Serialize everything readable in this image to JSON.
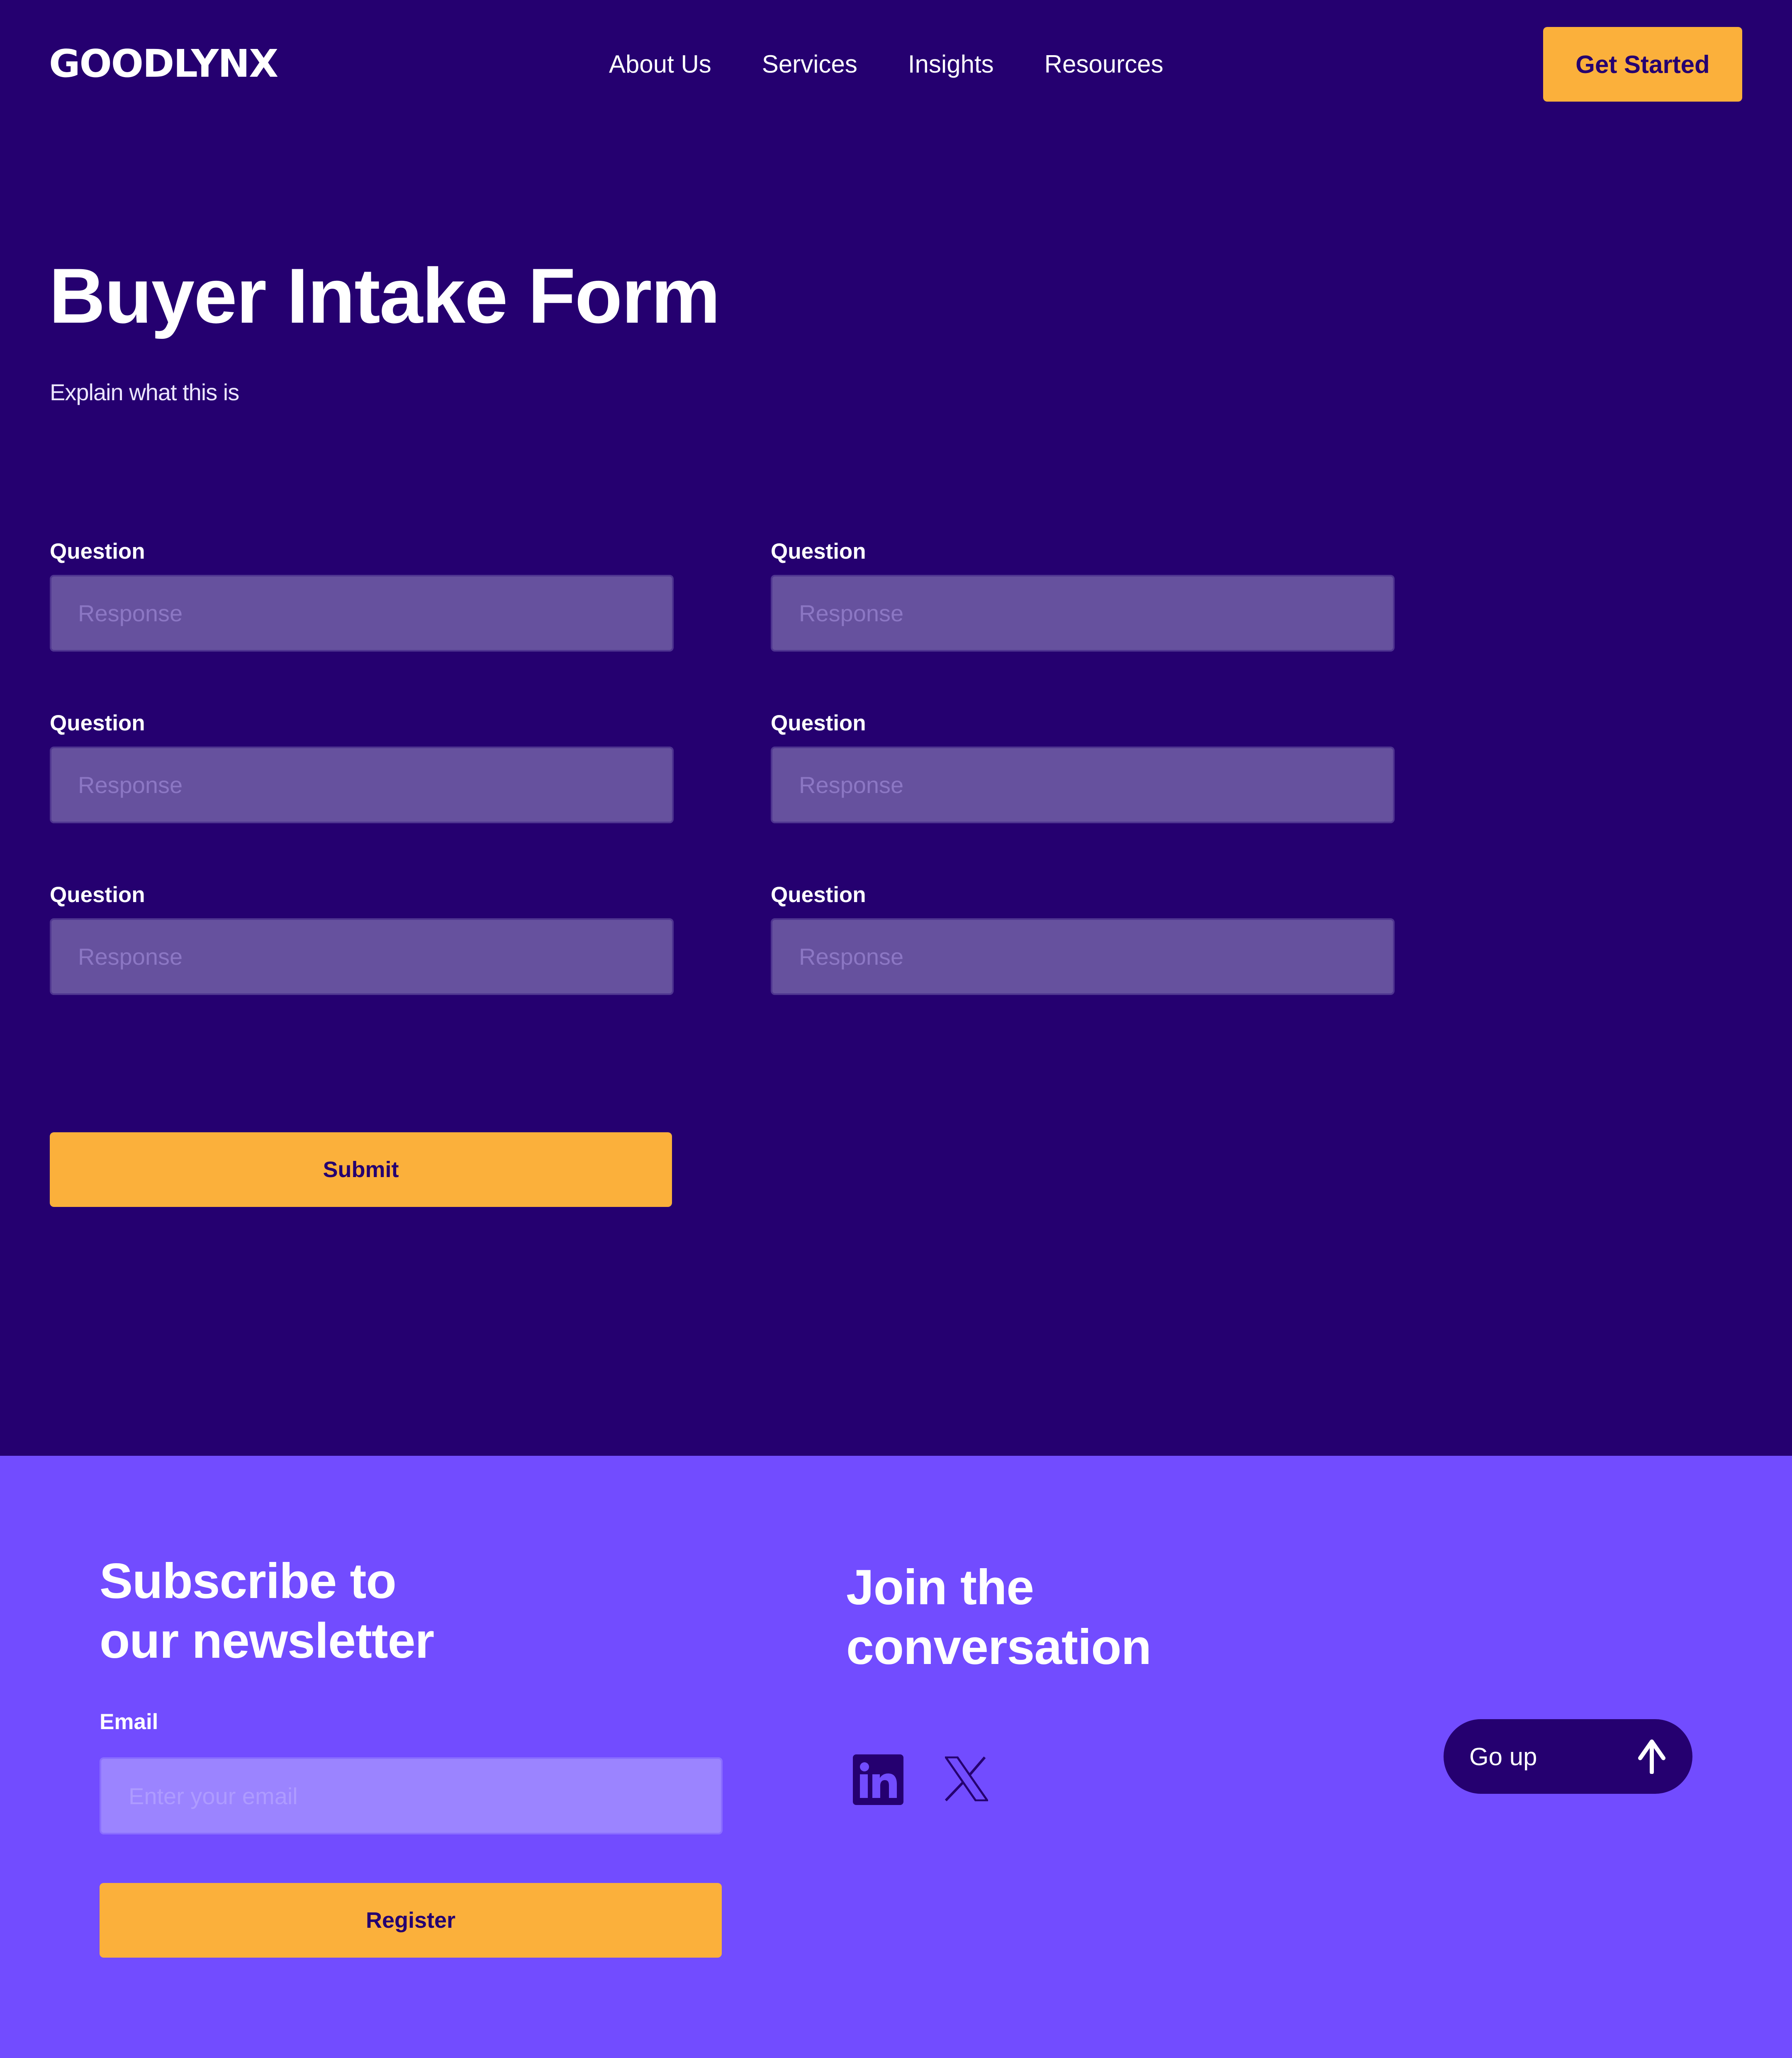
{
  "brand": {
    "logo_text": "GOODLYNX",
    "colors": {
      "primary_dark": "#250070",
      "footer_purple": "#724cff",
      "accent_orange": "#fbb03b",
      "input_fill": "#66519e",
      "text_white": "#ffffff"
    }
  },
  "nav": {
    "items": [
      {
        "label": "About Us"
      },
      {
        "label": "Services"
      },
      {
        "label": "Insights"
      },
      {
        "label": "Resources"
      }
    ],
    "cta_label": "Get Started"
  },
  "page": {
    "title": "Buyer Intake Form",
    "subtitle": "Explain what this is"
  },
  "form": {
    "fields": [
      {
        "label": "Question",
        "placeholder": "Response",
        "value": ""
      },
      {
        "label": "Question",
        "placeholder": "Response",
        "value": ""
      },
      {
        "label": "Question",
        "placeholder": "Response",
        "value": ""
      },
      {
        "label": "Question",
        "placeholder": "Response",
        "value": ""
      },
      {
        "label": "Question",
        "placeholder": "Response",
        "value": ""
      },
      {
        "label": "Question",
        "placeholder": "Response",
        "value": ""
      }
    ],
    "submit_label": "Submit"
  },
  "footer": {
    "newsletter": {
      "heading_line1": "Subscribe to",
      "heading_line2": "our newsletter",
      "email_label": "Email",
      "email_placeholder": "Enter your email",
      "email_value": "",
      "register_label": "Register"
    },
    "social": {
      "heading_line1": "Join the",
      "heading_line2": "conversation",
      "links": [
        {
          "name": "LinkedIn",
          "icon": "linkedin-icon"
        },
        {
          "name": "X",
          "icon": "x-icon"
        }
      ]
    },
    "go_up": {
      "label": "Go up",
      "icon": "arrow-up-icon"
    }
  }
}
